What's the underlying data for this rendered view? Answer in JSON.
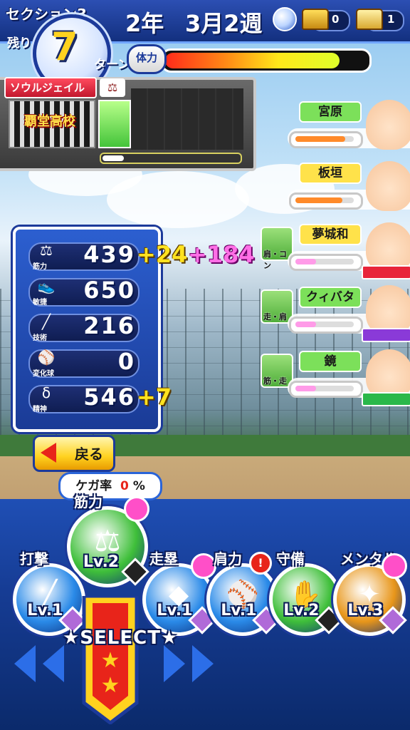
{
  "header": {
    "section": "セクション3",
    "remaining_label": "残り",
    "turns": "7",
    "turn_unit": "ターン",
    "year": "2年",
    "week": "3月2週",
    "chest_gold": "0",
    "chest_silver": "1",
    "hp_label": "体力",
    "hp_fraction": 0.88
  },
  "school": {
    "tag": "ソウルジェイル",
    "name": "覇堂高校"
  },
  "teammates": [
    {
      "name": "宮原",
      "name_color": "#7ce05a",
      "bar_color": "#ff8a2a",
      "bar_fraction": 0.85
    },
    {
      "name": "板垣",
      "name_color": "#ffe24a",
      "bar_color": "#ff8a2a",
      "bar_fraction": 0.8
    },
    {
      "name": "夢城和",
      "name_color": "#ffe24a",
      "bar_color": "#ff9be8",
      "bar_fraction": 0.35,
      "trait": "肩・コン",
      "emblem_color": "#e8243a"
    },
    {
      "name": "クィバタ",
      "name_color": "#7ce05a",
      "bar_color": "#ff9be8",
      "bar_fraction": 0.35,
      "trait": "走・肩",
      "emblem_color": "#8a3ad8"
    },
    {
      "name": "鏡",
      "name_color": "#7ce05a",
      "bar_color": "#ff9be8",
      "bar_fraction": 0.35,
      "trait": "筋・走",
      "emblem_color": "#2ab84a"
    }
  ],
  "stats": [
    {
      "icon": "dumbbell-icon",
      "sub": "筋力",
      "value": "439",
      "bonus1": "+24",
      "bonus2": "+184"
    },
    {
      "icon": "shoe-icon",
      "sub": "敏捷",
      "value": "650",
      "bonus1": "",
      "bonus2": ""
    },
    {
      "icon": "bat-icon",
      "sub": "技術",
      "value": "216",
      "bonus1": "",
      "bonus2": ""
    },
    {
      "icon": "baseball-icon",
      "sub": "変化球",
      "value": "0",
      "bonus1": "",
      "bonus2": ""
    },
    {
      "icon": "spirit-icon",
      "sub": "精神",
      "value": "546",
      "bonus1": "+7",
      "bonus2": ""
    }
  ],
  "back_button": "戻る",
  "injury": {
    "label": "ケガ率",
    "value": "0",
    "unit": "%"
  },
  "training": [
    {
      "title": "筋力",
      "lv": "Lv.2"
    },
    {
      "title": "打撃",
      "lv": "Lv.1"
    },
    {
      "title": "走塁",
      "lv": "Lv.1"
    },
    {
      "title": "肩力",
      "lv": "Lv.1"
    },
    {
      "title": "守備",
      "lv": "Lv.2"
    },
    {
      "title": "メンタル",
      "lv": "Lv.3"
    }
  ],
  "select_label": "★SELECT★",
  "colors": {
    "accent_blue": "#1c3a9a",
    "gold": "#ffd21f",
    "pink": "#ff4fc8"
  }
}
